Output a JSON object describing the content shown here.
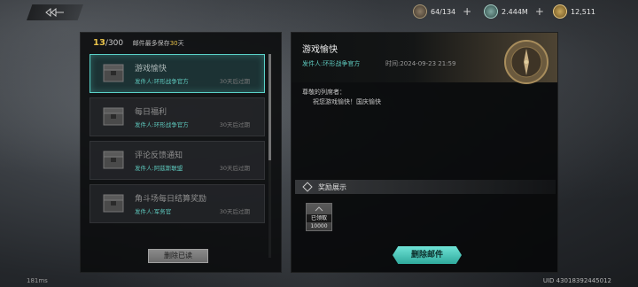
{
  "top_bar": {
    "resources": [
      {
        "name": "stamina",
        "value": "64/134",
        "icon": "stamina-icon"
      },
      {
        "name": "silver",
        "value": "2.444M",
        "icon": "silver-coin-icon"
      },
      {
        "name": "gold",
        "value": "12,511",
        "icon": "gold-coin-icon"
      }
    ],
    "plus_symbol": "+"
  },
  "left_panel": {
    "count_current": "13",
    "count_total": "/300",
    "note_prefix": "邮件最多保存",
    "note_days": "30",
    "note_suffix": "天",
    "mails": [
      {
        "title": "游戏愉快",
        "sender": "发件人:环形战争官方",
        "expire": "30天后过期",
        "selected": true
      },
      {
        "title": "每日福利",
        "sender": "发件人:环形战争官方",
        "expire": "30天后过期",
        "selected": false
      },
      {
        "title": "评论反馈通知",
        "sender": "发件人:阿兹斯联盟",
        "expire": "30天后过期",
        "selected": false
      },
      {
        "title": "角斗场每日结算奖励",
        "sender": "发件人:军务官",
        "expire": "30天后过期",
        "selected": false
      }
    ],
    "delete_read_label": "删除已读"
  },
  "detail": {
    "title": "游戏愉快",
    "sender": "发件人:环形战争官方",
    "time": "时间:2024-09-23 21:59",
    "greeting": "尊敬的列席者：",
    "body": "祝您游戏愉快！国庆愉快",
    "reward_header": "奖励展示",
    "reward": {
      "status": "已领取",
      "qty": "10000"
    },
    "delete_mail_label": "删除邮件"
  },
  "footer": {
    "fps": "181ms",
    "uid": "UID 43018392445012"
  },
  "colors": {
    "accent_teal": "#5ec9be",
    "accent_gold": "#e8c24a"
  }
}
